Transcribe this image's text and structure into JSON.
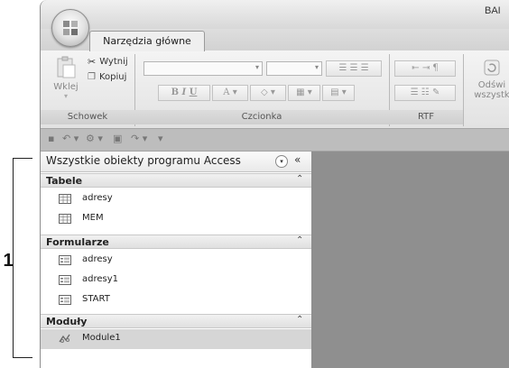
{
  "annotation": {
    "callout_number": "1"
  },
  "window": {
    "title": "BAI"
  },
  "ribbon": {
    "tabs": [
      {
        "label": "Narzędzia główne",
        "active": true
      }
    ],
    "groups": {
      "clipboard": {
        "label": "Schowek",
        "paste": "Wklej",
        "cut": "Wytnij",
        "copy": "Kopiuj"
      },
      "font": {
        "label": "Czcionka",
        "bold": "B",
        "italic": "I",
        "underline": "U",
        "font_color": "A"
      },
      "rtf": {
        "label": "RTF"
      },
      "records": {
        "refresh_line1": "Odświ",
        "refresh_line2": "wszystk"
      }
    }
  },
  "quick_access": {
    "icons": [
      "save-icon",
      "undo-icon",
      "filter-icon",
      "form-icon",
      "redo-icon",
      "customize-icon"
    ]
  },
  "nav_pane": {
    "title": "Wszystkie obiekty programu Access",
    "menu_glyph": "▾",
    "collapse_glyph": "«",
    "section_chevron": "⌃",
    "sections": [
      {
        "title": "Tabele",
        "icon": "table-icon",
        "items": [
          "adresy",
          "MEM"
        ]
      },
      {
        "title": "Formularze",
        "icon": "form-icon",
        "items": [
          "adresy",
          "adresy1",
          "START"
        ]
      },
      {
        "title": "Moduły",
        "icon": "module-icon",
        "items": [
          "Module1"
        ]
      }
    ],
    "selected_item": "Module1"
  }
}
